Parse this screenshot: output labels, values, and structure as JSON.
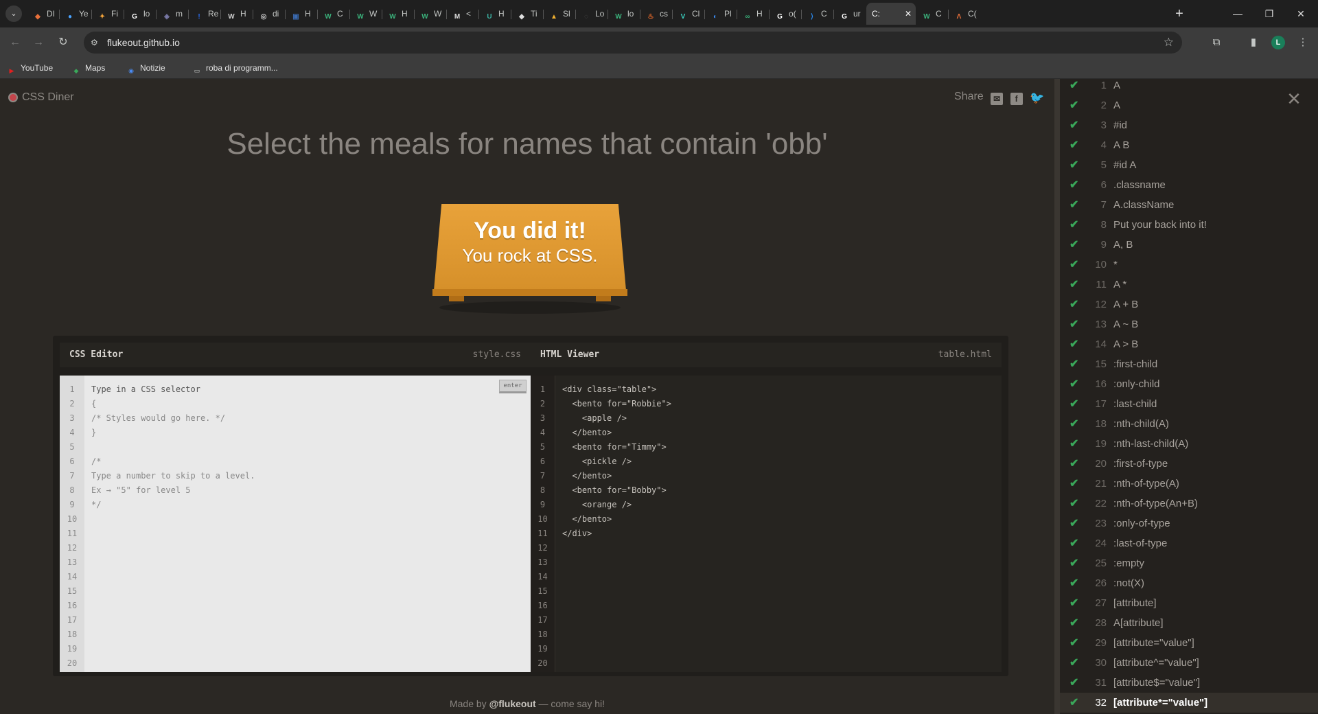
{
  "browser": {
    "tabs": [
      {
        "fav": "◆",
        "favColor": "#e8703a",
        "label": "DI"
      },
      {
        "fav": "●",
        "favColor": "#4aa3ff",
        "label": "Ye"
      },
      {
        "fav": "✦",
        "favColor": "#f2a33a",
        "label": "Fi"
      },
      {
        "fav": "G",
        "favColor": "#ffffff",
        "label": "lo"
      },
      {
        "fav": "◈",
        "favColor": "#7a7aa8",
        "label": "m"
      },
      {
        "fav": "!",
        "favColor": "#2a6cf0",
        "label": "Re"
      },
      {
        "fav": "W",
        "favColor": "#cccccc",
        "label": "H"
      },
      {
        "fav": "◎",
        "favColor": "#cccccc",
        "label": "di"
      },
      {
        "fav": "▣",
        "favColor": "#3a6ab0",
        "label": "H"
      },
      {
        "fav": "W",
        "favColor": "#3ab07a",
        "label": "C"
      },
      {
        "fav": "W",
        "favColor": "#3ab07a",
        "label": "W"
      },
      {
        "fav": "W",
        "favColor": "#3ab07a",
        "label": "H"
      },
      {
        "fav": "W",
        "favColor": "#3ab07a",
        "label": "W"
      },
      {
        "fav": "M",
        "favColor": "#dddddd",
        "label": "<"
      },
      {
        "fav": "U",
        "favColor": "#3ab0a0",
        "label": "H"
      },
      {
        "fav": "◆",
        "favColor": "#dddddd",
        "label": "Ti"
      },
      {
        "fav": "▲",
        "favColor": "#f0b030",
        "label": "Sl"
      },
      {
        "fav": "◌",
        "favColor": "#555555",
        "label": "Lo"
      },
      {
        "fav": "W",
        "favColor": "#3ab07a",
        "label": "lo"
      },
      {
        "fav": "♨",
        "favColor": "#e86a2a",
        "label": "cs"
      },
      {
        "fav": "V",
        "favColor": "#3ad0c0",
        "label": "Cl"
      },
      {
        "fav": "◐",
        "favColor": "#3a8af0",
        "label": "Pl"
      },
      {
        "fav": "∞",
        "favColor": "#3ab07a",
        "label": "H"
      },
      {
        "fav": "G",
        "favColor": "#ffffff",
        "label": "o("
      },
      {
        "fav": "⟩",
        "favColor": "#2a8af0",
        "label": "C"
      },
      {
        "fav": "G",
        "favColor": "#ffffff",
        "label": "ur"
      },
      {
        "fav": "",
        "favColor": "#3c3c3c",
        "label": "C:",
        "active": true
      },
      {
        "fav": "W",
        "favColor": "#3ab07a",
        "label": "C"
      },
      {
        "fav": "Λ",
        "favColor": "#e8703a",
        "label": "C("
      }
    ],
    "url": "flukeout.github.io",
    "profile_initial": "L",
    "bookmarks": [
      {
        "icon": "▶",
        "iconColor": "#e02020",
        "label": "YouTube"
      },
      {
        "icon": "◆",
        "iconColor": "#3aa85a",
        "label": "Maps"
      },
      {
        "icon": "◉",
        "iconColor": "#4a8af0",
        "label": "Notizie"
      },
      {
        "icon": "▭",
        "iconColor": "#c4c7c5",
        "label": "roba di programm..."
      }
    ]
  },
  "game": {
    "logo": "CSS Diner",
    "share_label": "Share",
    "order_title": "Select the meals for names that contain 'obb'",
    "win_line1": "You did it!",
    "win_line2": "You rock at CSS.",
    "css_editor_title": "CSS Editor",
    "css_file": "style.css",
    "html_viewer_title": "HTML Viewer",
    "html_file": "table.html",
    "enter_label": "enter",
    "css_lines": [
      "Type in a CSS selector",
      "{",
      "/* Styles would go here. */",
      "}",
      "",
      "/*",
      "Type a number to skip to a level.",
      "Ex → \"5\" for level 5",
      "*/"
    ],
    "html_lines": [
      "<div class=\"table\">",
      "  <bento for=\"Robbie\">",
      "    <apple />",
      "  </bento>",
      "  <bento for=\"Timmy\">",
      "    <pickle />",
      "  </bento>",
      "  <bento for=\"Bobby\">",
      "    <orange />",
      "  </bento>",
      "</div>"
    ],
    "line_count": 20,
    "footer_prefix": "Made by",
    "footer_author": "@flukeout",
    "footer_suffix": "— come say hi!"
  },
  "levels": [
    {
      "num": "1",
      "name": "A"
    },
    {
      "num": "2",
      "name": "A"
    },
    {
      "num": "3",
      "name": "#id"
    },
    {
      "num": "4",
      "name": "A  B"
    },
    {
      "num": "5",
      "name": "#id  A"
    },
    {
      "num": "6",
      "name": ".classname"
    },
    {
      "num": "7",
      "name": "A.className"
    },
    {
      "num": "8",
      "name": "Put your back into it!"
    },
    {
      "num": "9",
      "name": "A, B"
    },
    {
      "num": "10",
      "name": "*"
    },
    {
      "num": "11",
      "name": "A  *"
    },
    {
      "num": "12",
      "name": "A + B"
    },
    {
      "num": "13",
      "name": "A ~ B"
    },
    {
      "num": "14",
      "name": "A > B"
    },
    {
      "num": "15",
      "name": ":first-child"
    },
    {
      "num": "16",
      "name": ":only-child"
    },
    {
      "num": "17",
      "name": ":last-child"
    },
    {
      "num": "18",
      "name": ":nth-child(A)"
    },
    {
      "num": "19",
      "name": ":nth-last-child(A)"
    },
    {
      "num": "20",
      "name": ":first-of-type"
    },
    {
      "num": "21",
      "name": ":nth-of-type(A)"
    },
    {
      "num": "22",
      "name": ":nth-of-type(An+B)"
    },
    {
      "num": "23",
      "name": ":only-of-type"
    },
    {
      "num": "24",
      "name": ":last-of-type"
    },
    {
      "num": "25",
      "name": ":empty"
    },
    {
      "num": "26",
      "name": ":not(X)"
    },
    {
      "num": "27",
      "name": "[attribute]"
    },
    {
      "num": "28",
      "name": "A[attribute]"
    },
    {
      "num": "29",
      "name": "[attribute=\"value\"]"
    },
    {
      "num": "30",
      "name": "[attribute^=\"value\"]"
    },
    {
      "num": "31",
      "name": "[attribute$=\"value\"]"
    },
    {
      "num": "32",
      "name": "[attribute*=\"value\"]",
      "current": true
    }
  ],
  "colors": {
    "check": "#3aa85a",
    "table_orange": "#e8a23a",
    "accent_logo": "#c4454b"
  }
}
